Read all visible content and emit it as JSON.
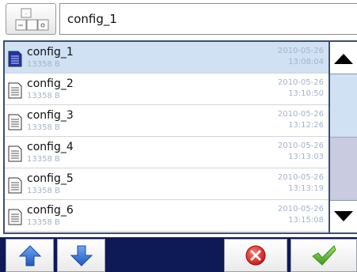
{
  "header": {
    "keypad_icon": "keypad-icon",
    "filename_value": "config_1"
  },
  "files": [
    {
      "name": "config_1",
      "size": "13358 B",
      "date": "2010-05-26",
      "time": "13:08:04",
      "selected": true
    },
    {
      "name": "config_2",
      "size": "13358 B",
      "date": "2010-05-26",
      "time": "13:10:50",
      "selected": false
    },
    {
      "name": "config_3",
      "size": "13358 B",
      "date": "2010-05-26",
      "time": "13:12:26",
      "selected": false
    },
    {
      "name": "config_4",
      "size": "13358 B",
      "date": "2010-05-26",
      "time": "13:13:03",
      "selected": false
    },
    {
      "name": "config_5",
      "size": "13358 B",
      "date": "2010-05-26",
      "time": "13:13:19",
      "selected": false
    },
    {
      "name": "config_6",
      "size": "13358 B",
      "date": "2010-05-26",
      "time": "13:15:08",
      "selected": false
    }
  ],
  "scrollbar": {
    "up_icon": "triangle-up-icon",
    "down_icon": "triangle-down-icon"
  },
  "toolbar": {
    "move_up_icon": "arrow-up-icon",
    "move_down_icon": "arrow-down-icon",
    "cancel_icon": "close-icon",
    "confirm_icon": "checkmark-icon"
  },
  "colors": {
    "selected_row": "#cfe1f3",
    "frame_border": "#3d4f6e",
    "toolbar_bg": "#0e1a55",
    "meta_text": "#a4b3cc",
    "arrow_blue": "#2f6fd6",
    "cancel_red": "#d62020",
    "confirm_green": "#5cb82e"
  }
}
